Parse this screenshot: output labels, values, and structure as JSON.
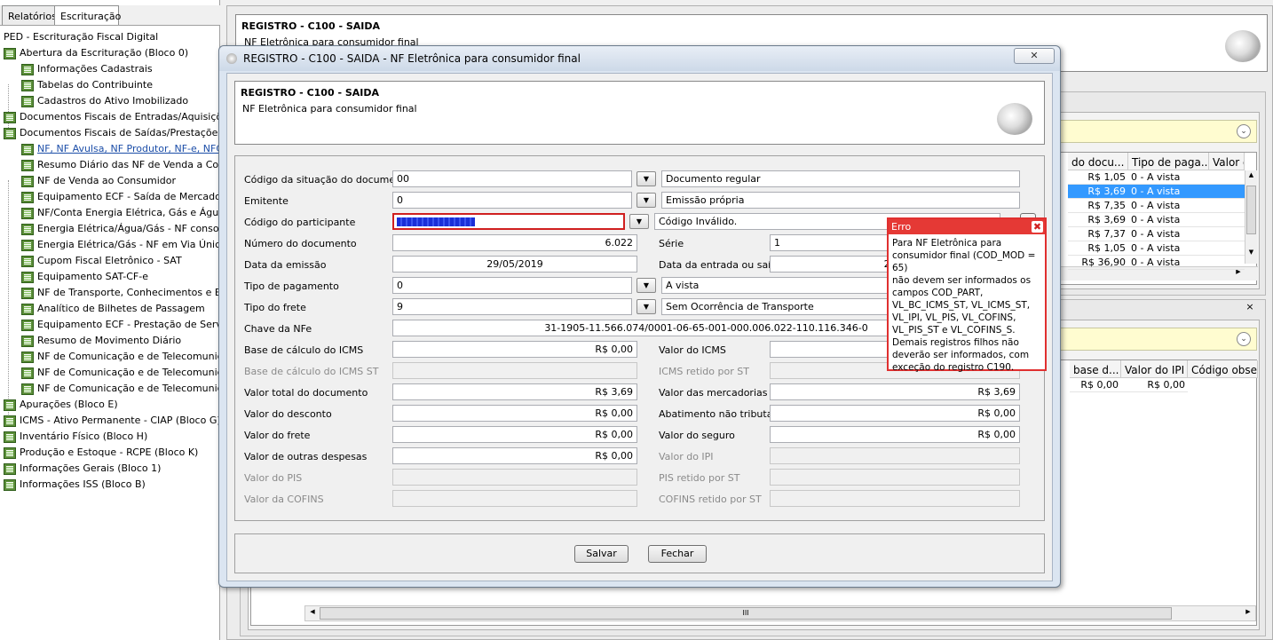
{
  "left_tabs": [
    "Relatórios",
    "Escrituração"
  ],
  "tree": {
    "root": "PED - Escrituração Fiscal Digital",
    "items": [
      {
        "label": "Abertura da Escrituração (Bloco 0)",
        "level": 1
      },
      {
        "label": "Informações Cadastrais",
        "level": 2
      },
      {
        "label": "Tabelas do Contribuinte",
        "level": 2
      },
      {
        "label": "Cadastros do Ativo Imobilizado",
        "level": 2
      },
      {
        "label": "Documentos Fiscais de Entradas/Aquisições",
        "level": 1
      },
      {
        "label": "Documentos Fiscais de Saídas/Prestações (B",
        "level": 1
      },
      {
        "label": "NF, NF Avulsa, NF Produtor, NF-e, NFC-e",
        "level": 2,
        "selected": true
      },
      {
        "label": "Resumo Diário das NF de Venda a Consu",
        "level": 2
      },
      {
        "label": "NF de Venda ao Consumidor",
        "level": 2
      },
      {
        "label": "Equipamento ECF - Saída de Mercadorias",
        "level": 2
      },
      {
        "label": "NF/Conta Energia Elétrica, Gás e Água",
        "level": 2
      },
      {
        "label": "Energia Elétrica/Água/Gás - NF consolidad",
        "level": 2
      },
      {
        "label": "Energia Elétrica/Gás - NF em Via Única (C",
        "level": 2
      },
      {
        "label": "Cupom Fiscal Eletrônico - SAT",
        "level": 2
      },
      {
        "label": "Equipamento SAT-CF-e",
        "level": 2
      },
      {
        "label": "NF de Transporte, Conhecimentos e BP-e",
        "level": 2
      },
      {
        "label": "Analítico de Bilhetes de Passagem",
        "level": 2
      },
      {
        "label": "Equipamento ECF - Prestação de Serviços",
        "level": 2
      },
      {
        "label": "Resumo de Movimento Diário",
        "level": 2
      },
      {
        "label": "NF de Comunicação e de Telecomunicaçã",
        "level": 2
      },
      {
        "label": "NF de Comunicação e de Telecomunicaçã",
        "level": 2
      },
      {
        "label": "NF de Comunicação e de Telecomunicaçã",
        "level": 2
      },
      {
        "label": "Apurações (Bloco E)",
        "level": 1
      },
      {
        "label": "ICMS - Ativo Permanente - CIAP (Bloco G)",
        "level": 1
      },
      {
        "label": "Inventário Físico (Bloco H)",
        "level": 1
      },
      {
        "label": "Produção e Estoque - RCPE (Bloco K)",
        "level": 1
      },
      {
        "label": "Informações Gerais (Bloco 1)",
        "level": 1
      },
      {
        "label": "Informações ISS (Bloco B)",
        "level": 1
      }
    ]
  },
  "background": {
    "title": "REGISTRO - C100 - SAIDA",
    "subtitle": "NF Eletrônica para consumidor final",
    "grid1": {
      "headers": [
        "do docu...",
        "Tipo de paga...",
        "Valor d"
      ],
      "rows": [
        [
          "R$ 1,05",
          "0 - A vista"
        ],
        [
          "R$ 3,69",
          "0 - A vista"
        ],
        [
          "R$ 7,35",
          "0 - A vista"
        ],
        [
          "R$ 3,69",
          "0 - A vista"
        ],
        [
          "R$ 7,37",
          "0 - A vista"
        ],
        [
          "R$ 1,05",
          "0 - A vista"
        ],
        [
          "R$ 36,90",
          "0 - A vista"
        ]
      ]
    },
    "grid2": {
      "headers": [
        "base d...",
        "Valor do IPI",
        "Código observ"
      ],
      "row": [
        "R$ 0,00",
        "R$ 0,00",
        ""
      ]
    },
    "scroll_grip": "III"
  },
  "dialog": {
    "window_title": "REGISTRO - C100 - SAIDA - NF Eletrônica para consumidor final",
    "header_title": "REGISTRO - C100 - SAIDA",
    "header_subtitle": "NF Eletrônica para consumidor final",
    "fields": {
      "cod_sit_label": "Código da situação do documento",
      "cod_sit_value": "00",
      "cod_sit_desc": "Documento regular",
      "emitente_label": "Emitente",
      "emitente_value": "0",
      "emitente_desc": "Emissão própria",
      "participante_label": "Código do participante",
      "participante_value": "",
      "participante_desc": "Código Inválido.",
      "num_doc_label": "Número do documento",
      "num_doc_value": "6.022",
      "serie_label": "Série",
      "serie_value": "1",
      "dt_emissao_label": "Data da emissão",
      "dt_emissao_value": "29/05/2019",
      "dt_entrada_label": "Data da entrada ou saída",
      "dt_entrada_value": "29/0",
      "tipo_pag_label": "Tipo de pagamento",
      "tipo_pag_value": "0",
      "tipo_pag_desc": "A vista",
      "tipo_frete_label": "Tipo do frete",
      "tipo_frete_value": "9",
      "tipo_frete_desc": "Sem Ocorrência de Transporte",
      "chave_label": "Chave da NFe",
      "chave_value": "31-1905-11.566.074/0001-06-65-001-000.006.022-110.116.346-0",
      "bc_icms_label": "Base de cálculo do ICMS",
      "bc_icms_value": "R$ 0,00",
      "vl_icms_label": "Valor do ICMS",
      "bc_icms_st_label": "Base de cálculo do ICMS ST",
      "icms_st_label": "ICMS retido por ST",
      "vl_doc_label": "Valor total do documento",
      "vl_doc_value": "R$ 3,69",
      "vl_merc_label": "Valor das mercadorias",
      "vl_merc_value": "R$ 3,69",
      "vl_desc_label": "Valor do desconto",
      "vl_desc_value": "R$ 0,00",
      "vl_abat_label": "Abatimento não tributado",
      "vl_abat_value": "R$ 0,00",
      "vl_frete_label": "Valor do frete",
      "vl_frete_value": "R$ 0,00",
      "vl_seg_label": "Valor do seguro",
      "vl_seg_value": "R$ 0,00",
      "vl_out_label": "Valor de outras despesas",
      "vl_out_value": "R$ 0,00",
      "vl_ipi_label": "Valor do IPI",
      "vl_pis_label": "Valor do PIS",
      "pis_st_label": "PIS retido por ST",
      "vl_cofins_label": "Valor da COFINS",
      "cofins_st_label": "COFINS retido por ST"
    },
    "buttons": {
      "save": "Salvar",
      "close": "Fechar"
    }
  },
  "error": {
    "title": "Erro",
    "message": "Para NF Eletrônica para\nconsumidor final (COD_MOD = 65)\nnão devem ser informados os\ncampos COD_PART,\nVL_BC_ICMS_ST, VL_ICMS_ST,\nVL_IPI, VL_PIS, VL_COFINS,\nVL_PIS_ST e VL_COFINS_S.\nDemais registros filhos não\ndeverão ser informados, com\nexceção do registro C190."
  },
  "colors": {
    "selection": "#3399ff",
    "error": "#e53935",
    "link": "#1c4ea8"
  }
}
